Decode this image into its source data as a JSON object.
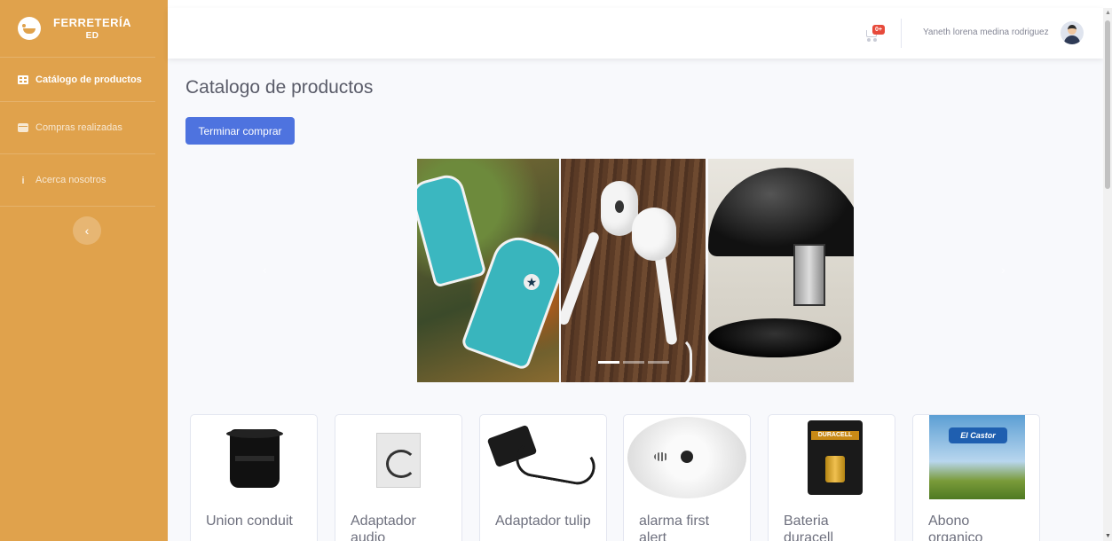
{
  "sidebar": {
    "brand_line1": "FERRETERÍA",
    "brand_line2": "ED",
    "items": [
      {
        "label": "Catálogo de productos",
        "icon": "table-icon",
        "active": true
      },
      {
        "label": "Compras realizadas",
        "icon": "credit-card-icon",
        "active": false
      },
      {
        "label": "Acerca nosotros",
        "icon": "info-icon",
        "active": false
      }
    ],
    "toggle_icon": "chevron-left-icon",
    "color": "#e0a24c"
  },
  "topbar": {
    "cart_badge": "0+",
    "user_name": "Yaneth lorena medina rodriguez",
    "badge_color": "#e74a3b"
  },
  "main": {
    "title": "Catalogo de productos",
    "finish_button": "Terminar comprar",
    "button_color": "#4e73df"
  },
  "carousel": {
    "slides": [
      "sneakers",
      "earphones",
      "stapler"
    ],
    "active_index": 0
  },
  "products": [
    {
      "name": "Union conduit"
    },
    {
      "name": "Adaptador audio"
    },
    {
      "name": "Adaptador tulip"
    },
    {
      "name": "alarma first alert"
    },
    {
      "name": "Bateria duracell"
    },
    {
      "name": "Abono organico"
    }
  ],
  "product_image_text": {
    "battery_brand": "DURACELL",
    "fertilizer_brand": "El Castor"
  }
}
